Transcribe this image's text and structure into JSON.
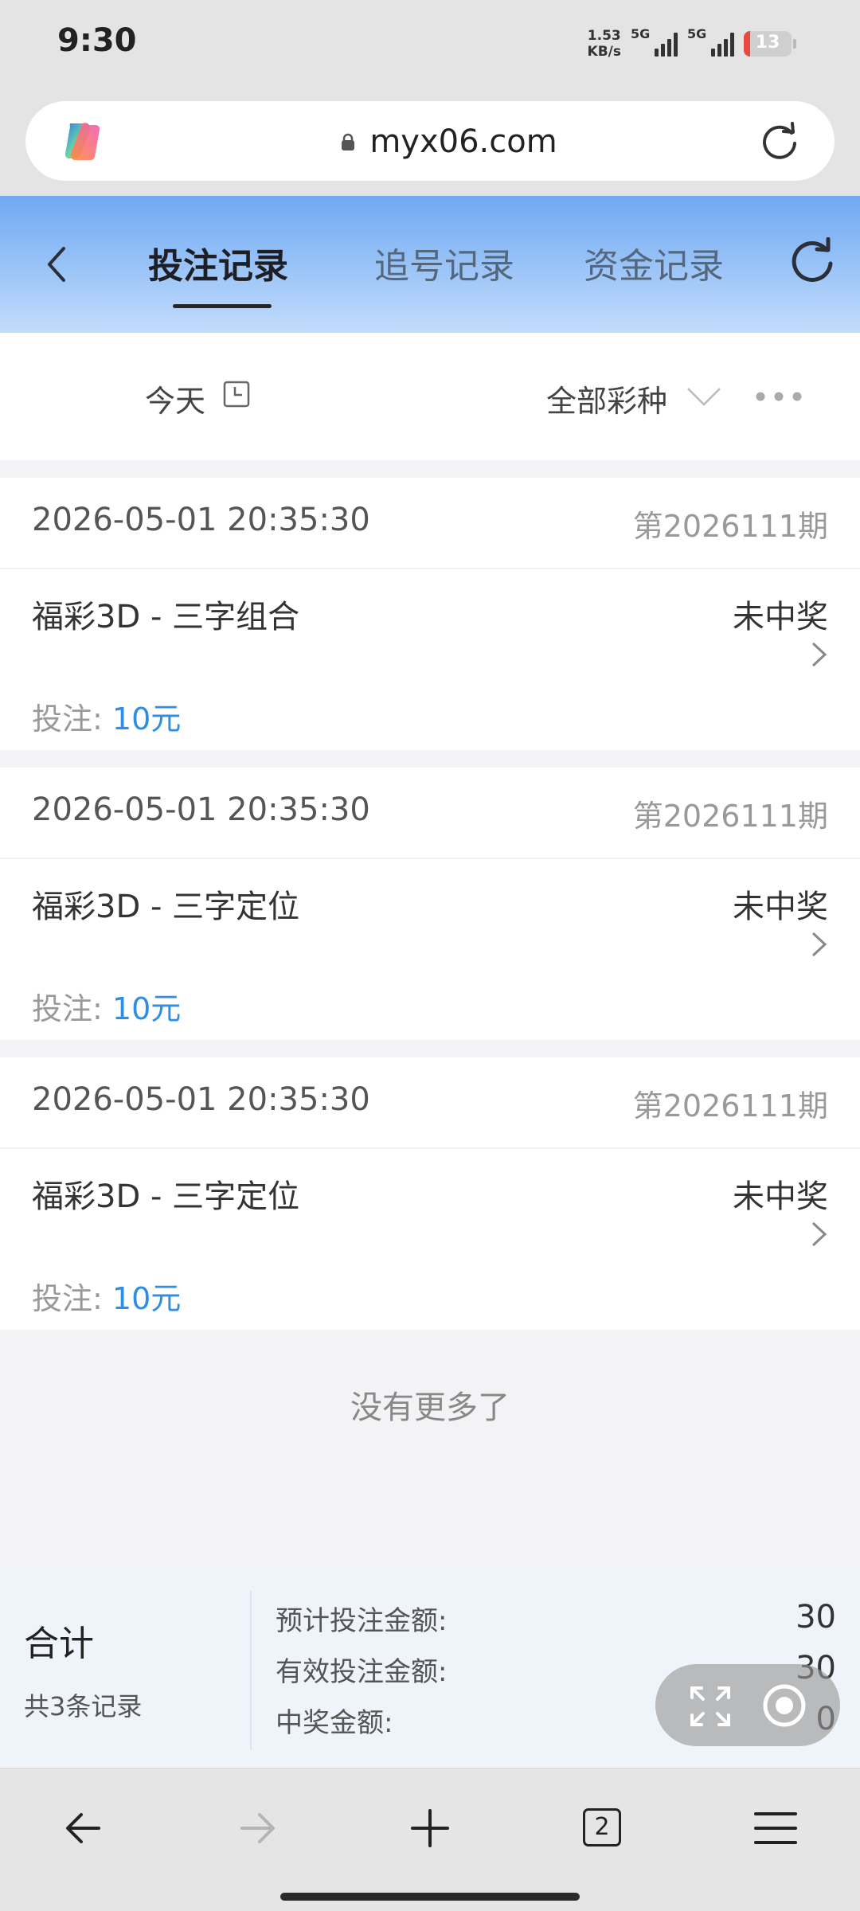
{
  "status_bar": {
    "time": "9:30",
    "speed_value": "1.53",
    "speed_unit": "KB/s",
    "network1": "5G",
    "network2": "5G",
    "battery": "13"
  },
  "browser": {
    "url": "myx06.com"
  },
  "header": {
    "tabs": [
      {
        "label": "投注记录",
        "active": true
      },
      {
        "label": "追号记录",
        "active": false
      },
      {
        "label": "资金记录",
        "active": false
      }
    ]
  },
  "filter": {
    "date_label": "今天",
    "lottery_label": "全部彩种"
  },
  "records": [
    {
      "time": "2026-05-01 20:35:30",
      "issue": "第2026111期",
      "game": "福彩3D - 三字组合",
      "status": "未中奖",
      "bet_label": "投注: ",
      "bet_amount": "10元"
    },
    {
      "time": "2026-05-01 20:35:30",
      "issue": "第2026111期",
      "game": "福彩3D - 三字定位",
      "status": "未中奖",
      "bet_label": "投注: ",
      "bet_amount": "10元"
    },
    {
      "time": "2026-05-01 20:35:30",
      "issue": "第2026111期",
      "game": "福彩3D - 三字定位",
      "status": "未中奖",
      "bet_label": "投注: ",
      "bet_amount": "10元"
    }
  ],
  "no_more": "没有更多了",
  "summary": {
    "title": "合计",
    "count": "共3条记录",
    "rows": [
      {
        "label": "预计投注金额:",
        "value": "30"
      },
      {
        "label": "有效投注金额:",
        "value": "30"
      },
      {
        "label": "中奖金额:",
        "value": "0"
      }
    ]
  },
  "bottom_nav": {
    "tab_count": "2"
  },
  "colors": {
    "accent_blue": "#2d8ee8",
    "header_top": "#6fa9f2",
    "header_bottom": "#c2dcfc"
  }
}
